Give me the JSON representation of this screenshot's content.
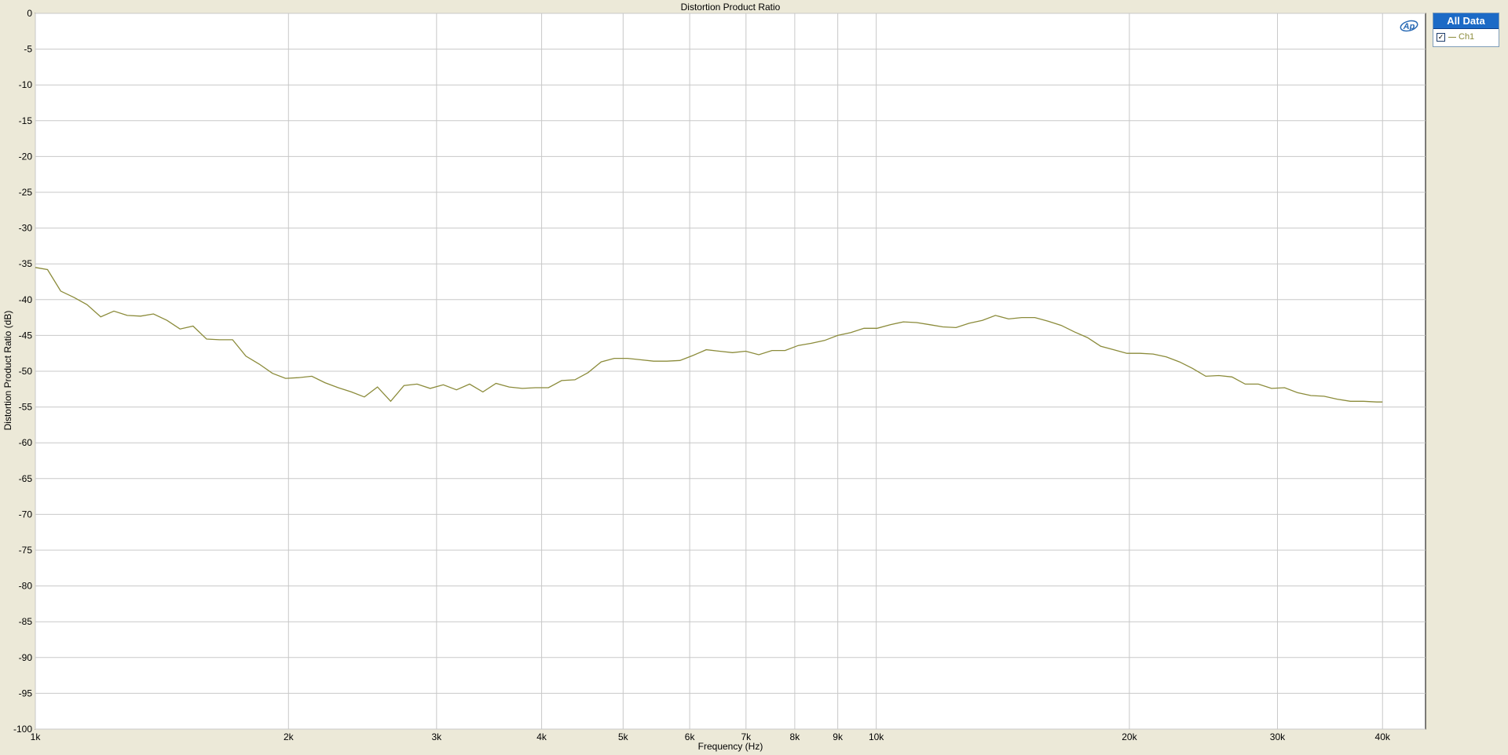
{
  "chart_data": {
    "type": "line",
    "title": "Distortion Product Ratio",
    "xlabel": "Frequency (Hz)",
    "ylabel": "Distortion Product Ratio (dB)",
    "xscale": "log",
    "xlim": [
      1000,
      45000
    ],
    "ylim": [
      -100,
      0
    ],
    "x_ticks": [
      1000,
      2000,
      3000,
      4000,
      5000,
      6000,
      7000,
      8000,
      9000,
      10000,
      20000,
      30000,
      40000
    ],
    "x_tick_labels": [
      "1k",
      "2k",
      "3k",
      "4k",
      "5k",
      "6k",
      "7k",
      "8k",
      "9k",
      "10k",
      "20k",
      "30k",
      "40k"
    ],
    "y_ticks": [
      0,
      -5,
      -10,
      -15,
      -20,
      -25,
      -30,
      -35,
      -40,
      -45,
      -50,
      -55,
      -60,
      -65,
      -70,
      -75,
      -80,
      -85,
      -90,
      -95,
      -100
    ],
    "y_tick_labels": [
      "0",
      "-5",
      "-10",
      "-15",
      "-20",
      "-25",
      "-30",
      "-35",
      "-40",
      "-45",
      "-50",
      "-55",
      "-60",
      "-65",
      "-70",
      "-75",
      "-80",
      "-85",
      "-90",
      "-95",
      "-100"
    ],
    "grid": true,
    "legend_position": "right-panel",
    "series": [
      {
        "name": "Ch1",
        "color": "#8b8b3a",
        "x": [
          1000,
          1034,
          1072,
          1112,
          1152,
          1196,
          1240,
          1286,
          1334,
          1382,
          1434,
          1486,
          1540,
          1598,
          1656,
          1716,
          1780,
          1846,
          1914,
          1984,
          2056,
          2132,
          2210,
          2292,
          2376,
          2462,
          2552,
          2646,
          2744,
          2844,
          2948,
          3056,
          3168,
          3284,
          3406,
          3530,
          3660,
          3794,
          3932,
          4076,
          4226,
          4382,
          4542,
          4708,
          4880,
          5060,
          5244,
          5436,
          5636,
          5842,
          6056,
          6278,
          6508,
          6746,
          6994,
          7250,
          7516,
          7792,
          8078,
          8374,
          8680,
          8998,
          9328,
          9670,
          10024,
          10392,
          10772,
          11168,
          11576,
          12000,
          12440,
          12896,
          13370,
          13860,
          14368,
          14894,
          15440,
          16006,
          16592,
          17200,
          17830,
          18484,
          19162,
          19864,
          20592,
          21346,
          22128,
          22940,
          23780,
          24652,
          25556,
          26492,
          27464,
          28470,
          29514,
          30596,
          31716,
          32878,
          34084,
          35332,
          36628,
          37970,
          39362,
          40000
        ],
        "y": [
          -35.5,
          -35.8,
          -38.8,
          -39.7,
          -40.7,
          -42.4,
          -41.6,
          -42.2,
          -42.3,
          -42.0,
          -42.9,
          -44.1,
          -43.7,
          -45.5,
          -45.6,
          -45.6,
          -47.9,
          -49.0,
          -50.3,
          -51.0,
          -50.9,
          -50.7,
          -51.6,
          -52.3,
          -52.9,
          -53.6,
          -52.2,
          -54.2,
          -52.0,
          -51.8,
          -52.4,
          -51.9,
          -52.6,
          -51.8,
          -52.9,
          -51.7,
          -52.2,
          -52.4,
          -52.3,
          -52.3,
          -51.3,
          -51.2,
          -50.2,
          -48.7,
          -48.2,
          -48.2,
          -48.4,
          -48.6,
          -48.6,
          -48.5,
          -47.8,
          -47.0,
          -47.2,
          -47.4,
          -47.2,
          -47.7,
          -47.1,
          -47.1,
          -46.4,
          -46.1,
          -45.7,
          -45.0,
          -44.6,
          -44.0,
          -44.0,
          -43.5,
          -43.1,
          -43.2,
          -43.5,
          -43.8,
          -43.9,
          -43.3,
          -42.9,
          -42.2,
          -42.7,
          -42.5,
          -42.5,
          -43.0,
          -43.6,
          -44.5,
          -45.3,
          -46.5,
          -47.0,
          -47.5,
          -47.5,
          -47.6,
          -48.0,
          -48.7,
          -49.6,
          -50.7,
          -50.6,
          -50.8,
          -51.8,
          -51.8,
          -52.4,
          -52.3,
          -53.0,
          -53.4,
          -53.5,
          -53.9,
          -54.2,
          -54.2,
          -54.3,
          -54.3
        ]
      }
    ]
  },
  "legend": {
    "header": "All Data",
    "checkbox_mark": "✓",
    "items": [
      {
        "label": "Ch1",
        "checked": true
      }
    ]
  },
  "logo": {
    "text": "Ap"
  }
}
